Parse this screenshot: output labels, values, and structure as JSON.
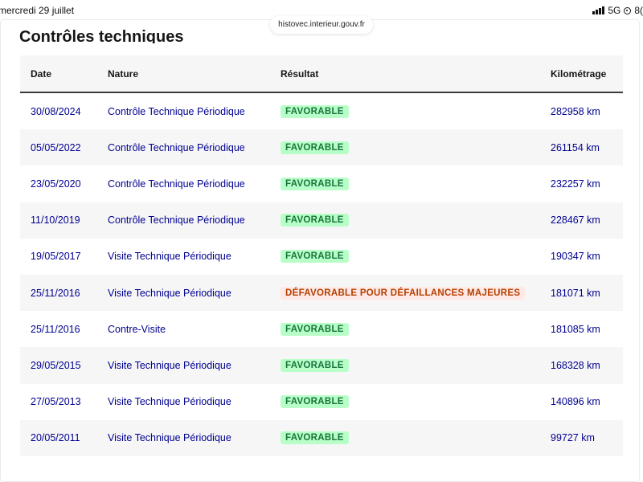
{
  "status_bar": {
    "date": "mercredi 29 juillet",
    "network": "5G",
    "battery": "8("
  },
  "browser": {
    "url": "histovec.interieur.gouv.fr"
  },
  "section": {
    "title": "Contrôles techniques"
  },
  "table": {
    "headers": {
      "date": "Date",
      "nature": "Nature",
      "result": "Résultat",
      "km": "Kilométrage"
    },
    "rows": [
      {
        "date": "30/08/2024",
        "nature": "Contrôle Technique Périodique",
        "result": "FAVORABLE",
        "status": "ok",
        "km": "282958 km"
      },
      {
        "date": "05/05/2022",
        "nature": "Contrôle Technique Périodique",
        "result": "FAVORABLE",
        "status": "ok",
        "km": "261154 km"
      },
      {
        "date": "23/05/2020",
        "nature": "Contrôle Technique Périodique",
        "result": "FAVORABLE",
        "status": "ok",
        "km": "232257 km"
      },
      {
        "date": "11/10/2019",
        "nature": "Contrôle Technique Périodique",
        "result": "FAVORABLE",
        "status": "ok",
        "km": "228467 km"
      },
      {
        "date": "19/05/2017",
        "nature": "Visite Technique Périodique",
        "result": "FAVORABLE",
        "status": "ok",
        "km": "190347 km"
      },
      {
        "date": "25/11/2016",
        "nature": "Visite Technique Périodique",
        "result": "DÉFAVORABLE POUR DÉFAILLANCES MAJEURES",
        "status": "ko",
        "km": "181071 km"
      },
      {
        "date": "25/11/2016",
        "nature": "Contre-Visite",
        "result": "FAVORABLE",
        "status": "ok",
        "km": "181085 km"
      },
      {
        "date": "29/05/2015",
        "nature": "Visite Technique Périodique",
        "result": "FAVORABLE",
        "status": "ok",
        "km": "168328 km"
      },
      {
        "date": "27/05/2013",
        "nature": "Visite Technique Périodique",
        "result": "FAVORABLE",
        "status": "ok",
        "km": "140896 km"
      },
      {
        "date": "20/05/2011",
        "nature": "Visite Technique Périodique",
        "result": "FAVORABLE",
        "status": "ok",
        "km": "99727 km"
      }
    ]
  },
  "colors": {
    "link_blue": "#000091",
    "ok_bg": "#b8fec9",
    "ok_text": "#18753c",
    "ko_bg": "#ffe9e6",
    "ko_text": "#b34000"
  }
}
